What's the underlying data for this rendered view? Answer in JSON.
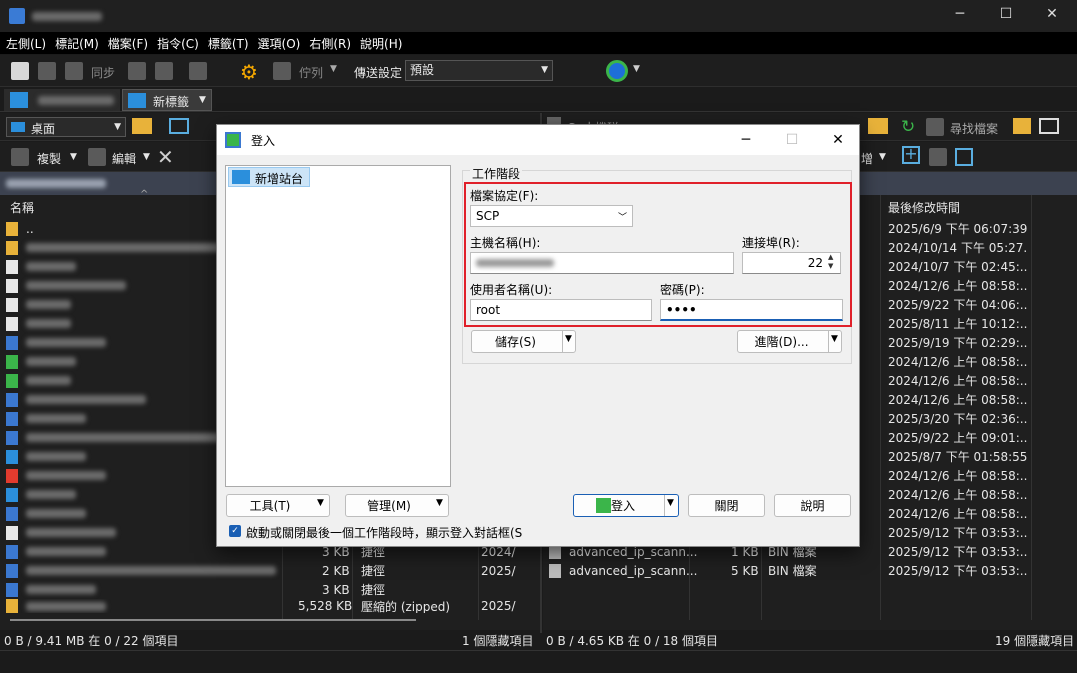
{
  "app": {
    "title_blurred": true
  },
  "window_controls": {
    "minimize": "─",
    "maximize": "☐",
    "close": "✕"
  },
  "menu": [
    "左側(L)",
    "標記(M)",
    "檔案(F)",
    "指令(C)",
    "標籤(T)",
    "選項(O)",
    "右側(R)",
    "說明(H)"
  ],
  "toolbar": {
    "sync": "同步",
    "queue": "佇列",
    "transfer_label": "傳送設定",
    "transfer_value": "預設"
  },
  "tabs": {
    "new_tab": "新標籤"
  },
  "left": {
    "drive": "桌面",
    "copy": "複製",
    "edit": "編輯",
    "col_name": "名稱",
    "rows": [
      {
        "size": "3 KB",
        "type": "捷徑",
        "date": "2024/"
      },
      {
        "size": "2 KB",
        "type": "捷徑",
        "date": "2025/"
      },
      {
        "size": "3 KB",
        "type": "捷徑",
        "date": ""
      },
      {
        "size": "5,528 KB",
        "type": "壓縮的 (zipped)",
        "date": "2025/"
      }
    ],
    "status_left": "0 B / 9.41 MB 在 0 / 22 個項目",
    "status_right": "1 個隱藏項目"
  },
  "right": {
    "drive": "C: 本機磁",
    "find_files": "尋找檔案",
    "new": "增",
    "col_modified": "最後修改時間",
    "dates": [
      "2025/6/9 下午 06:07:39",
      "2024/10/14 下午 05:27...",
      "2024/10/7 下午 02:45:...",
      "2024/12/6 上午 08:58:...",
      "2025/9/22 下午 04:06:...",
      "2025/8/11 上午 10:12:...",
      "2025/9/19 下午 02:29:...",
      "2024/12/6 上午 08:58:...",
      "2024/12/6 上午 08:58:...",
      "2024/12/6 上午 08:58:...",
      "2025/3/20 下午 02:36:...",
      "2025/9/22 上午 09:01:...",
      "2025/8/7 下午 01:58:55",
      "2024/12/6 上午 08:58:...",
      "2024/12/6 上午 08:58:...",
      "2024/12/6 上午 08:58:...",
      "2025/9/12 下午 03:53:...",
      "2025/9/12 下午 03:53:...",
      "2025/9/12 下午 03:53:..."
    ],
    "files": [
      {
        "name": "advanced_ip_scann...",
        "size": "1 KB",
        "type": "BIN 檔案"
      },
      {
        "name": "advanced_ip_scann...",
        "size": "5 KB",
        "type": "BIN 檔案"
      }
    ],
    "status_left": "0 B / 4.65 KB 在 0 / 18 個項目",
    "status_right": "19 個隱藏項目"
  },
  "dialog": {
    "title": "登入",
    "new_site": "新增站台",
    "session_group": "工作階段",
    "protocol_label": "檔案協定(F):",
    "protocol_value": "SCP",
    "host_label": "主機名稱(H):",
    "port_label": "連接埠(R):",
    "port_value": "22",
    "user_label": "使用者名稱(U):",
    "user_value": "root",
    "password_label": "密碼(P):",
    "password_value": "••••",
    "save": "儲存(S)",
    "advanced": "進階(D)...",
    "tools": "工具(T)",
    "manage": "管理(M)",
    "login": "登入",
    "close": "關閉",
    "help": "說明",
    "checkbox_label": "啟動或關閉最後一個工作階段時，顯示登入對話框(S"
  }
}
